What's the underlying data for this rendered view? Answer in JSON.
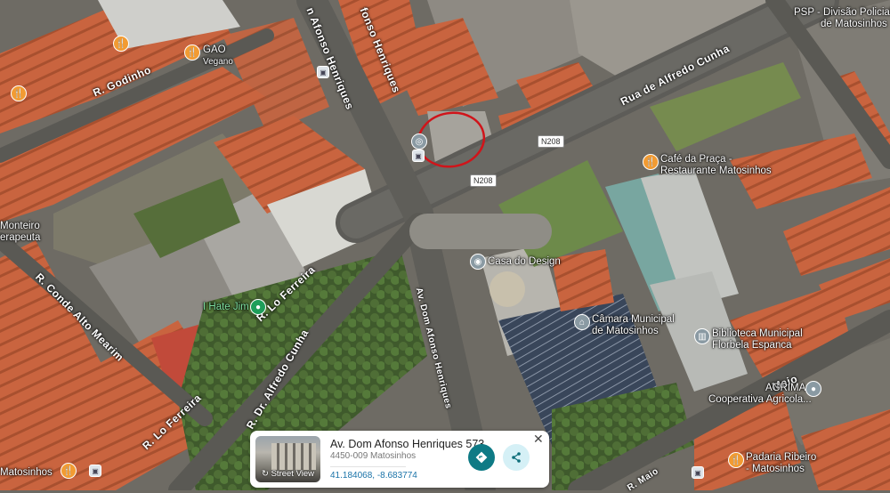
{
  "streets": {
    "godinho": "R. Godinho",
    "afonso_top": "n Afonso Henriques",
    "afonso_top2": "fonso Henriques",
    "alfredo_cunha": "Rua de Alfredo Cunha",
    "conde": "R. Conde Alto Mearim",
    "lo_ferreira": "R. Lo Ferreira",
    "lo_ferreira2": "R. Lo Ferreira",
    "dr_alfredo": "R. Dr. Alfredo Cunha",
    "afonso_bottom": "Av. Dom Afonso Henriques",
    "maio": "R. Maio",
    "maio2": "Maio",
    "n208_a": "N208",
    "n208_b": "N208"
  },
  "places": {
    "gao": {
      "name": "GAO",
      "sub": "Vegano"
    },
    "psp": {
      "name": "PSP - Divisão Policial",
      "sub": "de Matosinhos"
    },
    "cafe": {
      "name": "Café da Praça -",
      "sub": "Restaurante Matosinhos"
    },
    "monteiro": {
      "name": "Monteiro",
      "sub": "erapeuta"
    },
    "hate_jim": {
      "name": "I Hate Jim"
    },
    "casa_design": {
      "name": "Casa do Design"
    },
    "camara": {
      "name": "Câmara Municipal",
      "sub": "de Matosinhos"
    },
    "biblioteca": {
      "name": "Biblioteca Municipal",
      "sub": "Florbela Espanca"
    },
    "agrima": {
      "name": "AGRIMA -",
      "sub": "Cooperativa Agricola..."
    },
    "padaria": {
      "name": "Padaria Ribeiro",
      "sub": "- Matosinhos"
    },
    "matosinhos_bl": {
      "name": "Matosinhos"
    }
  },
  "card": {
    "street_view_label": "Street View",
    "title": "Av. Dom Afonso Henriques 573",
    "subtitle": "4450-009 Matosinhos",
    "coordinates": "41.184068, -8.683774",
    "close": "✕"
  },
  "colors": {
    "accent": "#0e7a85",
    "selection": "#d0141a",
    "food_pin": "#f29b32"
  }
}
